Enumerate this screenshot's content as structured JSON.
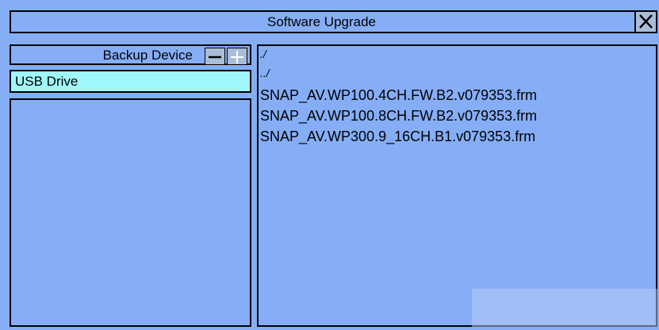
{
  "window": {
    "title": "Software Upgrade",
    "close_icon": "close-icon"
  },
  "device_panel": {
    "title": "Backup Device",
    "minus_icon": "minus-icon",
    "plus_icon": "plus-icon",
    "devices": [
      {
        "label": "USB Drive",
        "selected": true
      }
    ]
  },
  "file_panel": {
    "entries": [
      {
        "label": "./",
        "type": "dir"
      },
      {
        "label": "../",
        "type": "dir"
      },
      {
        "label": "SNAP_AV.WP100.4CH.FW.B2.v079353.frm",
        "type": "file"
      },
      {
        "label": "SNAP_AV.WP100.8CH.FW.B2.v079353.frm",
        "type": "file"
      },
      {
        "label": "SNAP_AV.WP300.9_16CH.B1.v079353.frm",
        "type": "file"
      }
    ]
  },
  "colors": {
    "background": "#86aef7",
    "selected_item": "#9ff7fb",
    "button": "#a9bdd8",
    "border": "#000000"
  }
}
